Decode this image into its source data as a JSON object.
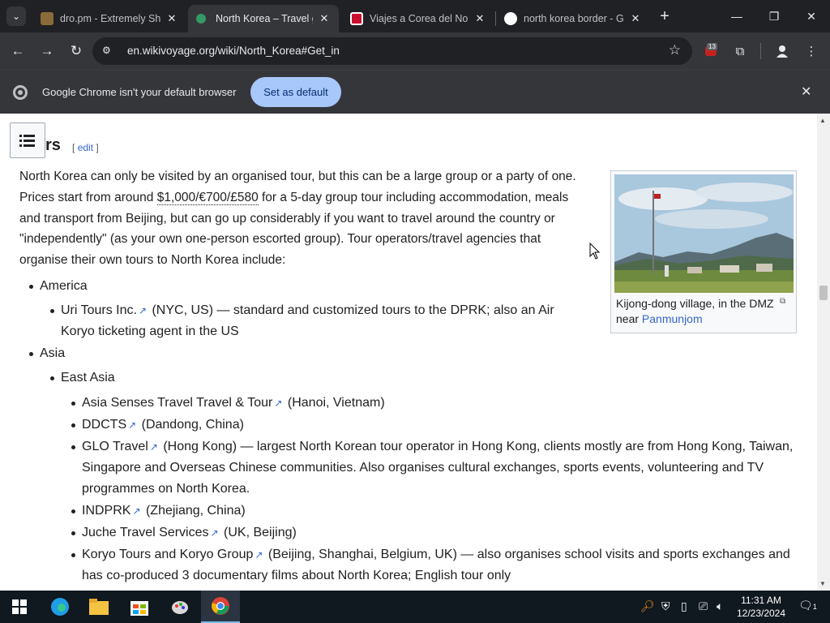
{
  "browser": {
    "tabs": [
      {
        "title": "dro.pm - Extremely Sh",
        "active": false
      },
      {
        "title": "North Korea – Travel g",
        "active": true
      },
      {
        "title": "Viajes a Corea del Nor",
        "active": false
      },
      {
        "title": "north korea border - G",
        "active": false
      }
    ],
    "url": "en.wikivoyage.org/wiki/North_Korea#Get_in",
    "extension_badge": "13",
    "infobar": {
      "message": "Google Chrome isn't your default browser",
      "button": "Set as default"
    }
  },
  "article": {
    "heading": "rs",
    "edit_open": "[",
    "edit_label": "edit",
    "edit_close": "]",
    "intro_part1": "North Korea can only be visited by an organised tour, but this can be a large group or a party of one. Prices start from around ",
    "price": "$1,000/€700/£580",
    "intro_part2": " for a 5-day group tour including accommodation, meals and transport from Beijing, but can go up considerably if you want to travel around the country or \"independently\" (as your own one-person escorted group). Tour operators/travel agencies that organise their own tours to North Korea include:",
    "figure": {
      "caption_text": "Kijong-dong village, in the DMZ near ",
      "caption_link": "Panmunjom"
    },
    "list": {
      "america": "America",
      "uri_name": "Uri Tours Inc.",
      "uri_desc_line1": " (NYC, US) — standard and customized tours to the DPRK; also an Air",
      "uri_desc_line2": "Koryo ticketing agent in the US",
      "asia": "Asia",
      "east_asia": "East Asia",
      "operators": [
        {
          "name": "Asia Senses Travel Travel & Tour",
          "desc": " (Hanoi, Vietnam)"
        },
        {
          "name": "DDCTS",
          "desc": " (Dandong, China)"
        },
        {
          "name": "GLO Travel",
          "desc": " (Hong Kong) — largest North Korean tour operator in Hong Kong, clients mostly are from Hong Kong, Taiwan,",
          "line2": "Singapore and Overseas Chinese communities. Also organises cultural exchanges, sports events, volunteering and TV",
          "line3": "programmes on North Korea."
        },
        {
          "name": "INDPRK",
          "desc": " (Zhejiang, China)"
        },
        {
          "name": "Juche Travel Services",
          "desc": " (UK, Beijing)"
        },
        {
          "name": "Koryo Tours and Koryo Group",
          "desc": " (Beijing, Shanghai, Belgium, UK) — also organises school visits and sports exchanges and",
          "line2": "has co-produced 3 documentary films about North Korea; English tour only"
        }
      ]
    }
  },
  "taskbar": {
    "time": "11:31 AM",
    "date": "12/23/2024",
    "notification_count": "1"
  },
  "colors": {
    "link": "#3366cc",
    "chrome_dark": "#35363a",
    "set_default_bg": "#a8c7fa"
  }
}
